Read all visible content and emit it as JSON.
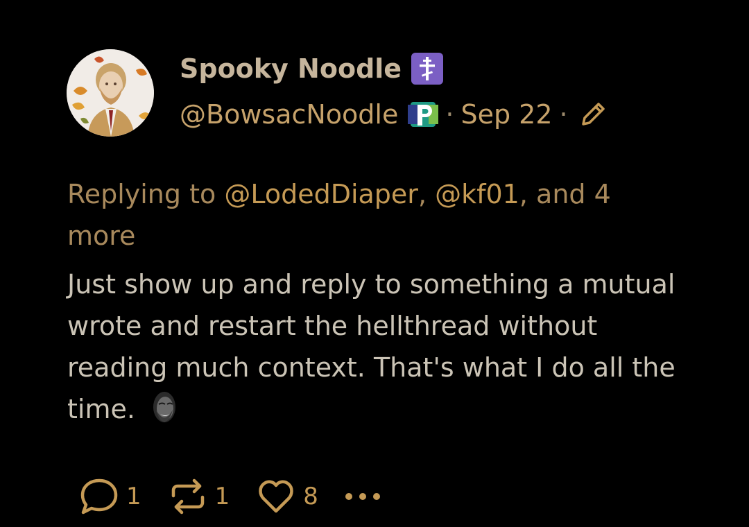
{
  "post": {
    "display_name": "Spooky Noodle",
    "handle": "@BowsacNoodle",
    "separator": "·",
    "date": "Sep 22",
    "reply_prefix": "Replying to",
    "mention_1": "@LodedDiaper",
    "comma": ",",
    "mention_2": "@kf01",
    "reply_suffix": ", and 4 more",
    "body": "Just show up and reply to something a mutual wrote and restart the hellthread without reading much context. That's what I do all the time."
  },
  "badges": {
    "name_badge": "orthodox-cross-icon",
    "handle_badge": "p-badge-icon",
    "edited": "pencil-icon"
  },
  "actions": {
    "replies": "1",
    "reposts": "1",
    "likes": "8"
  },
  "colors": {
    "background": "#000000",
    "accent": "#c59a55",
    "name": "#c6b59c",
    "text": "#cbc4b6",
    "badge_purple": "#7b5fc4"
  }
}
